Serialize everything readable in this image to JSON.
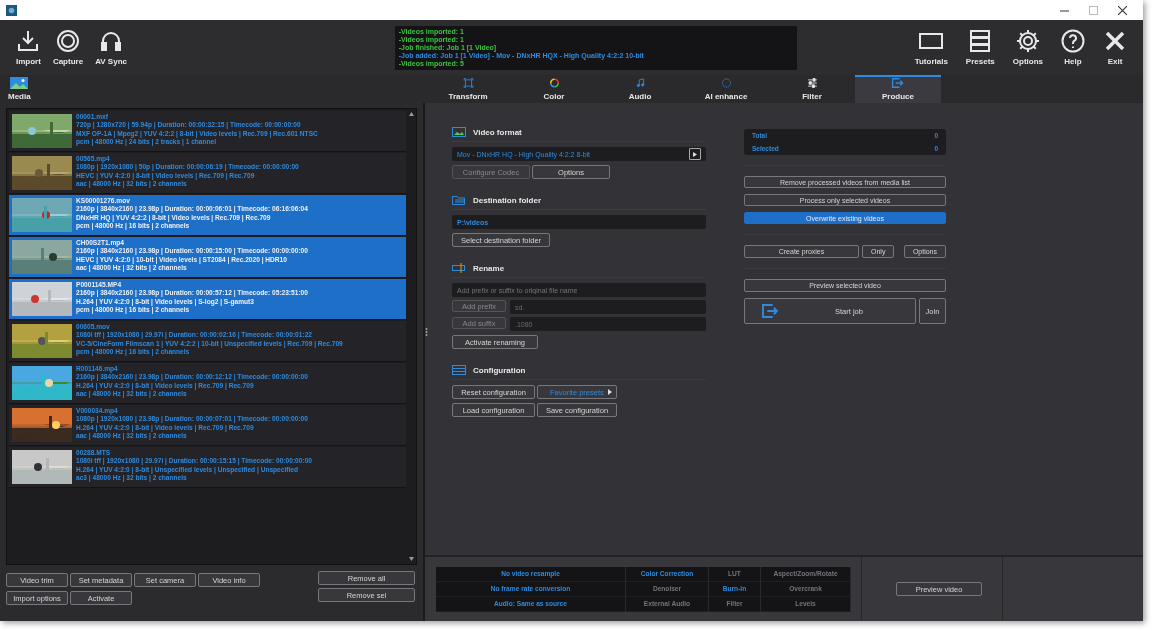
{
  "toolbar_left": [
    "Import",
    "Capture",
    "AV Sync"
  ],
  "log": [
    {
      "text": "-Videos imported: 1",
      "color": "#3ec43e"
    },
    {
      "text": "-Videos imported: 1",
      "color": "#3ec43e"
    },
    {
      "text": "-Job finished: Job 1 [1 Video]",
      "color": "#3ec43e"
    },
    {
      "text": "-Job added: Job 1 [1 Video] -  Mov - DNxHR HQX - High Quality 4:2:2 10-bit",
      "color": "#2d8be0"
    },
    {
      "text": "-Videos imported: 5",
      "color": "#3ec43e"
    }
  ],
  "toolbar_right": [
    "Tutorials",
    "Presets",
    "Options",
    "Help",
    "Exit"
  ],
  "media_tab": "Media",
  "tabs": [
    {
      "label": "Transform",
      "selected": false
    },
    {
      "label": "Color",
      "selected": false
    },
    {
      "label": "Audio",
      "selected": false
    },
    {
      "label": "AI enhance",
      "selected": false
    },
    {
      "label": "Filter",
      "selected": false
    },
    {
      "label": "Produce",
      "selected": true
    }
  ],
  "media_list": [
    {
      "name": "00001.mxf",
      "details": [
        "720p | 1280x720 | 59.94p  | Duration:  00:00:32:15 | Timecode: 00:00:00:00",
        "MXF OP-1A | Mpeg2 | YUV 4:2:2 | 8-bit | Video levels | Rec.709 | Rec.601 NTSC",
        "pcm | 48000 Hz | 24 bits | 2 tracks | 1 channel"
      ],
      "selected": false
    },
    {
      "name": "00565.mp4",
      "details": [
        "1080p | 1920x1080 | 50p | Duration:  00:00:06:19 | Timecode: 00:00:00:00",
        "HEVC | YUV 4:2:0 | 8-bit | Video levels | Rec.709 | Rec.709",
        "aac | 48000 Hz | 32 bits | 2 channels"
      ],
      "selected": false
    },
    {
      "name": "KS00001276.mov",
      "details": [
        "2160p | 3840x2160 | 23.98p  | Duration:  00:00:06:01 | Timecode: 06:16:06:04",
        "DNxHR HQ | YUV 4:2:2 | 8-bit | Video levels | Rec.709 | Rec.709",
        "pcm | 48000 Hz | 16 bits | 2 channels"
      ],
      "selected": true
    },
    {
      "name": "CH00S2T1.mp4",
      "details": [
        "2160p | 3840x2160 | 23.98p  | Duration:  00:00:15:00 | Timecode: 00:00:00:00",
        "HEVC | YUV 4:2:0 | 10-bit | Video levels | ST2084 | Rec.2020 | HDR10",
        "aac | 48000 Hz | 32 bits | 2 channels"
      ],
      "selected": true
    },
    {
      "name": "P0001145.MP4",
      "details": [
        "2160p | 3840x2160 | 23.98p | Duration:  00:00:57:12 | Timecode: 05:23:51:00",
        "H.264 | YUV 4:2:0 | 8-bit | Video levels | S-log2 | S-gamut3",
        "pcm | 48000 Hz | 16 bits | 2 channels"
      ],
      "selected": true
    },
    {
      "name": "00605.mov",
      "details": [
        "1080i tff | 1920x1080 | 29.97i  | Duration:  00:00:02:16 | Timecode: 00:00:01:22",
        "VC-5/CineForm Filmscan 1 | YUV 4:2:2 | 10-bit | Unspecified levels | Rec.709 | Rec.709",
        "pcm | 48000 Hz | 16 bits | 2 channels"
      ],
      "selected": false
    },
    {
      "name": "R001146.mp4",
      "details": [
        "2160p | 3840x2160 | 23.98p  | Duration:  00:00:12:12 | Timecode: 00:00:00:00",
        "H.264 | YUV 4:2:0 | 8-bit | Video levels | Rec.709 | Rec.709",
        "aac | 48000 Hz | 32 bits | 2 channels"
      ],
      "selected": false
    },
    {
      "name": "V000034.mp4",
      "details": [
        "1080p | 1920x1080 | 23.98p  | Duration:  00:00:07:01 | Timecode: 00:00:00:00",
        "H.264 | YUV 4:2:0 | 8-bit | Video levels | Rec.709 | Rec.709",
        "aac | 48000 Hz | 32 bits | 2 channels"
      ],
      "selected": false
    },
    {
      "name": "00288.MTS",
      "details": [
        "1080i tff | 1920x1080 | 29.97i  | Duration:  00:00:15:15 | Timecode: 00:00:00:00",
        "H.264 | YUV 4:2:0 | 8-bit | Unspecified levels | Unspecified | Unspecified",
        "ac3 | 48000 Hz | 32 bits | 2 channels"
      ],
      "selected": false
    }
  ],
  "list_buttons": [
    "Video trim",
    "Set metadata",
    "Set camera",
    "Video info",
    "Import options",
    "Activate"
  ],
  "remove_buttons": [
    "Remove all",
    "Remove sel"
  ],
  "video_format": {
    "title": "Video format",
    "format": "Mov - DNxHR HQ - High Quality 4:2:2 8-bit",
    "buttons": [
      {
        "label": "Configure Codec",
        "disabled": true
      },
      {
        "label": "Options",
        "disabled": false
      }
    ]
  },
  "destination": {
    "title": "Destination folder",
    "path": "P:\\videos",
    "button": "Select destination folder"
  },
  "rename": {
    "title": "Rename",
    "placeholder": "Add prefix or suffix to original file name",
    "rows": [
      {
        "button": "Add prefix",
        "value": "sd.",
        "disabled": true
      },
      {
        "button": "Add suffix",
        "value": ".1080",
        "disabled": true
      }
    ],
    "activate": "Activate renaming"
  },
  "configuration": {
    "title": "Configuration",
    "buttons": [
      {
        "label": "Reset configuration",
        "kind": "plain"
      },
      {
        "label": "Favorite presets",
        "kind": "menu"
      },
      {
        "label": "Load configuration",
        "kind": "plain"
      },
      {
        "label": "Save configuration",
        "kind": "plain"
      }
    ]
  },
  "stats": [
    {
      "label": "Total",
      "value": "0"
    },
    {
      "label": "Selected",
      "value": "0"
    }
  ],
  "toggles": [
    {
      "label": "Remove processed videos from media list",
      "on": false
    },
    {
      "label": "Process only selected videos",
      "on": false
    },
    {
      "label": "Overwrite existing videos",
      "on": true
    }
  ],
  "proxies": {
    "create": "Create proxies",
    "only": "Only",
    "options": "Options"
  },
  "preview_selected": "Preview selected video",
  "start_job": "Start  job",
  "join": "Join",
  "status_grid": [
    [
      {
        "text": "No video resample",
        "on": true
      },
      {
        "text": "Color Correction",
        "on": true
      },
      {
        "text": "LUT",
        "on": false
      },
      {
        "text": "Aspect/Zoom/Rotate",
        "on": false
      }
    ],
    [
      {
        "text": "No frame rate conversion",
        "on": true
      },
      {
        "text": "Denoiser",
        "on": false
      },
      {
        "text": "Burn-in",
        "on": true
      },
      {
        "text": "Overcrank",
        "on": false
      }
    ],
    [
      {
        "text": "Audio: Same as source",
        "on": true
      },
      {
        "text": "External Audio",
        "on": false
      },
      {
        "text": "Filter",
        "on": false
      },
      {
        "text": "Levels",
        "on": false
      }
    ]
  ],
  "preview_video": "Preview video"
}
